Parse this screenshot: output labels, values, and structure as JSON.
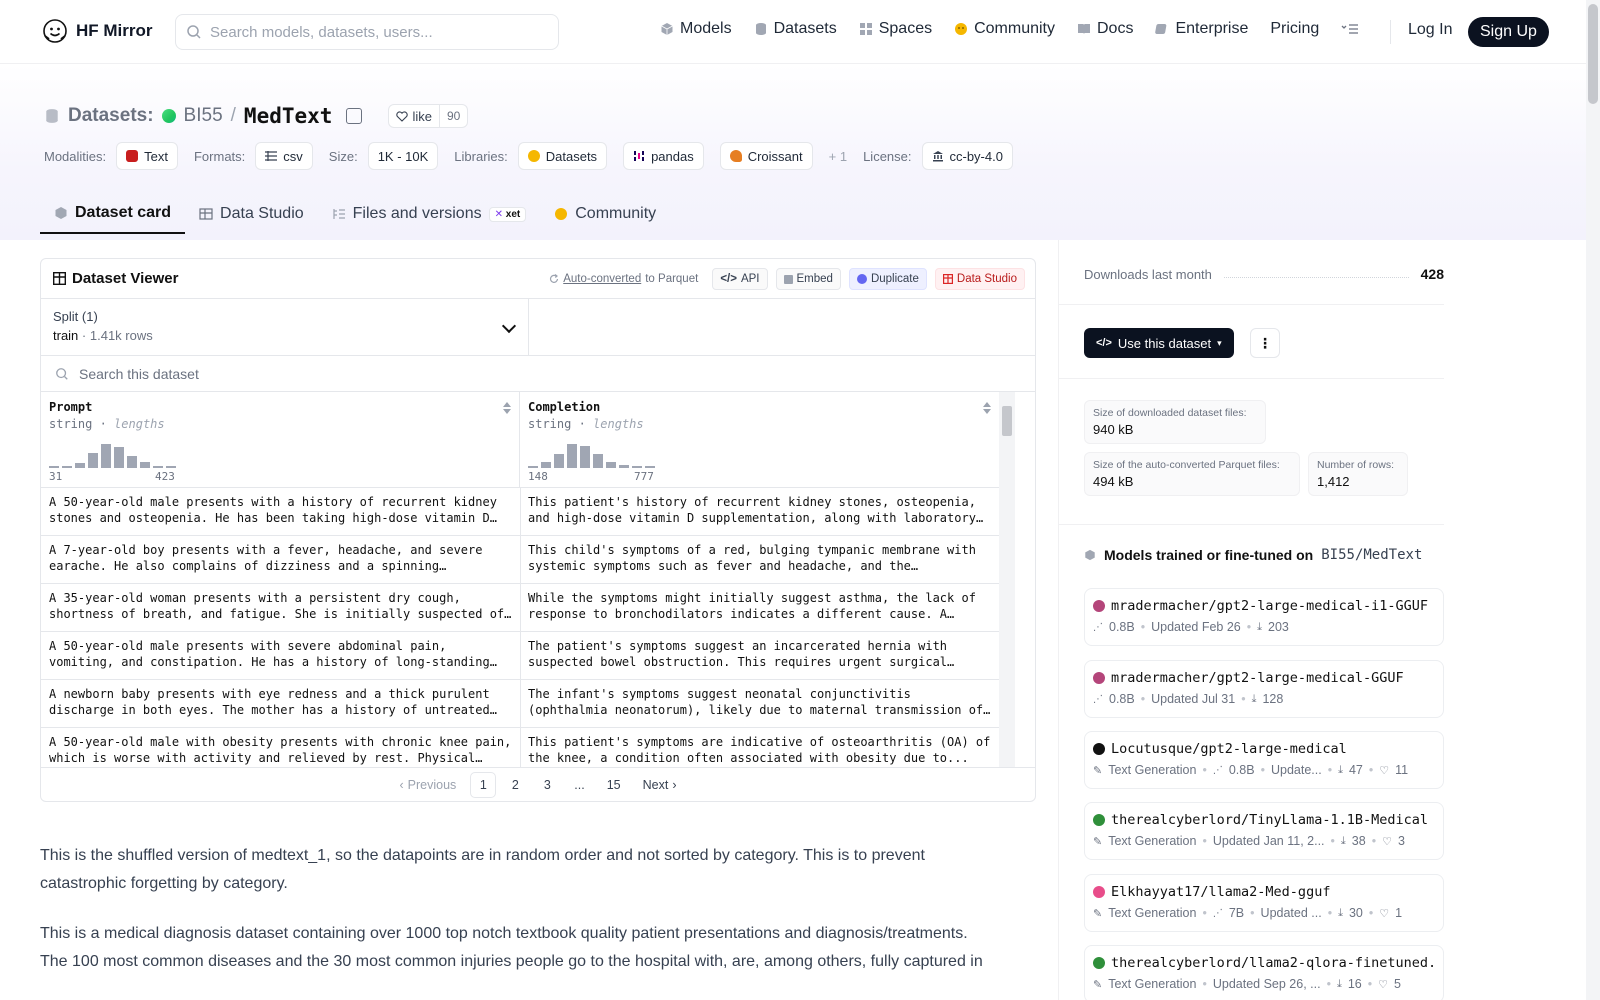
{
  "nav": {
    "brand": "HF Mirror",
    "search_placeholder": "Search models, datasets, users...",
    "links": [
      "Models",
      "Datasets",
      "Spaces",
      "Community",
      "Docs",
      "Enterprise",
      "Pricing"
    ],
    "login": "Log In",
    "signup": "Sign Up"
  },
  "header": {
    "type_label": "Datasets:",
    "org": "BI55",
    "slash": "/",
    "repo": "MedText",
    "like_label": "like",
    "like_count": "90",
    "modalities_label": "Modalities:",
    "modality": "Text",
    "formats_label": "Formats:",
    "format": "csv",
    "size_label": "Size:",
    "size": "1K - 10K",
    "libraries_label": "Libraries:",
    "libraries": [
      "Datasets",
      "pandas",
      "Croissant"
    ],
    "more_libraries": "+ 1",
    "license_label": "License:",
    "license": "cc-by-4.0"
  },
  "tabs": {
    "card": "Dataset card",
    "studio": "Data Studio",
    "files": "Files and versions",
    "xet": "xet",
    "community": "Community"
  },
  "viewer": {
    "title": "Dataset Viewer",
    "auto_converted": "Auto-converted",
    "to_parquet": "to Parquet",
    "api": "API",
    "embed": "Embed",
    "duplicate": "Duplicate",
    "data_studio": "Data Studio",
    "split_label": "Split (1)",
    "split_name": "train",
    "split_rows": "1.41k rows",
    "search_placeholder": "Search this dataset",
    "columns": [
      {
        "name": "Prompt",
        "type": "string",
        "stat": "lengths",
        "min": "31",
        "max": "423"
      },
      {
        "name": "Completion",
        "type": "string",
        "stat": "lengths",
        "min": "148",
        "max": "777"
      }
    ],
    "rows": [
      {
        "prompt": "A 50-year-old male presents with a history of recurrent kidney stones and osteopenia. He has been taking high-dose vitamin D supplements...",
        "completion": "This patient's history of recurrent kidney stones, osteopenia, and high-dose vitamin D supplementation, along with laboratory findings..."
      },
      {
        "prompt": "A 7-year-old boy presents with a fever, headache, and severe earache. He also complains of dizziness and a spinning sensation...",
        "completion": "This child's symptoms of a red, bulging tympanic membrane with systemic symptoms such as fever and headache, and the additional..."
      },
      {
        "prompt": "A 35-year-old woman presents with a persistent dry cough, shortness of breath, and fatigue. She is initially suspected of having asthma...",
        "completion": "While the symptoms might initially suggest asthma, the lack of response to bronchodilators indicates a different cause. A possible..."
      },
      {
        "prompt": "A 50-year-old male presents with severe abdominal pain, vomiting, and constipation. He has a history of long-standing hernia. On examination...",
        "completion": "The patient's symptoms suggest an incarcerated hernia with suspected bowel obstruction. This requires urgent surgical consultation..."
      },
      {
        "prompt": "A newborn baby presents with eye redness and a thick purulent discharge in both eyes. The mother has a history of untreated infection...",
        "completion": "The infant's symptoms suggest neonatal conjunctivitis (ophthalmia neonatorum), likely due to maternal transmission of Chlamydia..."
      },
      {
        "prompt": "A 50-year-old male with obesity presents with chronic knee pain, which is worse with activity and relieved by rest. Physical examination...",
        "completion": "This patient's symptoms are indicative of osteoarthritis (OA) of the knee, a condition often associated with obesity due to..."
      }
    ],
    "pager": {
      "prev": "Previous",
      "pages": [
        "1",
        "2",
        "3",
        "...",
        "15"
      ],
      "next": "Next"
    }
  },
  "description": {
    "p1": "This is the shuffled version of medtext_1, so the datapoints are in random order and not sorted by category. This is to prevent catastrophic forgetting by category.",
    "p2": "This is a medical diagnosis dataset containing over 1000 top notch textbook quality patient presentations and diagnosis/treatments. The 100 most common diseases and the 30 most common injuries people go to the hospital with, are, among others, fully captured in"
  },
  "sidebar": {
    "downloads_label": "Downloads last month",
    "downloads": "428",
    "use_button": "Use this dataset",
    "stats": [
      {
        "label": "Size of downloaded dataset files:",
        "value": "940 kB"
      },
      {
        "label": "Size of the auto-converted Parquet files:",
        "value": "494 kB"
      },
      {
        "label": "Number of rows:",
        "value": "1,412"
      }
    ],
    "models_title": "Models trained or fine-tuned on",
    "models_repo": "BI55/MedText",
    "models": [
      {
        "name": "mradermacher/gpt2-large-medical-i1-GGUF",
        "task": "",
        "params": "0.8B",
        "updated": "Updated Feb 26",
        "downloads": "203",
        "likes": "",
        "color": "#b4457a"
      },
      {
        "name": "mradermacher/gpt2-large-medical-GGUF",
        "task": "",
        "params": "0.8B",
        "updated": "Updated Jul 31",
        "downloads": "128",
        "likes": "",
        "color": "#b4457a"
      },
      {
        "name": "Locutusque/gpt2-large-medical",
        "task": "Text Generation",
        "params": "0.8B",
        "updated": "Update...",
        "downloads": "47",
        "likes": "11",
        "color": "#111111"
      },
      {
        "name": "therealcyberlord/TinyLlama-1.1B-Medical",
        "task": "Text Generation",
        "params": "",
        "updated": "Updated Jan 11, 2...",
        "downloads": "38",
        "likes": "3",
        "color": "#2f8f3a"
      },
      {
        "name": "Elkhayyat17/llama2-Med-gguf",
        "task": "Text Generation",
        "params": "7B",
        "updated": "Updated ...",
        "downloads": "30",
        "likes": "1",
        "color": "#e84d8a"
      },
      {
        "name": "therealcyberlord/llama2-qlora-finetuned...",
        "task": "Text Generation",
        "params": "",
        "updated": "Updated Sep 26, ...",
        "downloads": "16",
        "likes": "5",
        "color": "#2f8f3a"
      }
    ]
  }
}
